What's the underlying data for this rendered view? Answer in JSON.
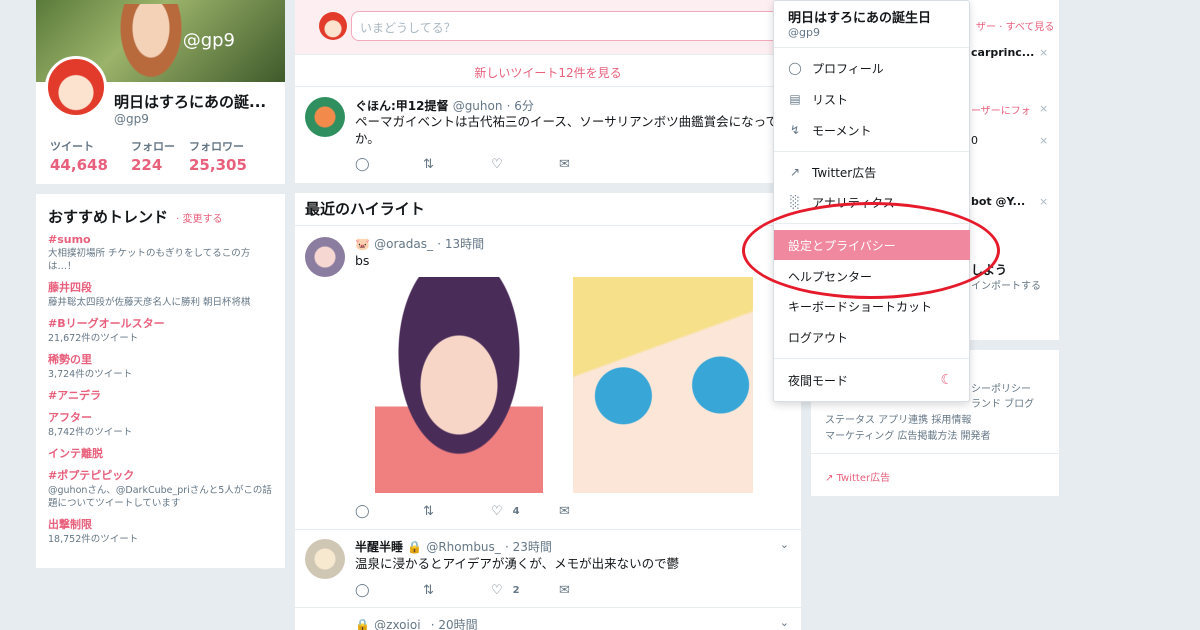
{
  "profile": {
    "name": "明日はすろにあの誕...",
    "handle": "@gp9",
    "banner_handle": "@gp9",
    "stats": [
      {
        "label": "ツイート",
        "value": "44,648"
      },
      {
        "label": "フォロー",
        "value": "224"
      },
      {
        "label": "フォロワー",
        "value": "25,305"
      }
    ]
  },
  "trends": {
    "title": "おすすめトレンド",
    "change": "· 変更する",
    "items": [
      {
        "tag": "#sumo",
        "desc": "大相撲初場所 チケットのもぎりをしてるこの方は…！"
      },
      {
        "tag": "藤井四段",
        "desc": "藤井聡太四段が佐藤天彦名人に勝利 朝日杯将棋"
      },
      {
        "tag": "#Bリーグオールスター",
        "desc": "21,672件のツイート"
      },
      {
        "tag": "稀勢の里",
        "desc": "3,724件のツイート"
      },
      {
        "tag": "#アニデラ",
        "desc": ""
      },
      {
        "tag": "アフター",
        "desc": "8,742件のツイート"
      },
      {
        "tag": "インテ離脱",
        "desc": ""
      },
      {
        "tag": "#ポプテピピック",
        "desc": "@guhonさん、@DarkCube_priさんと5人がこの話題についてツイートしています"
      },
      {
        "tag": "出撃制限",
        "desc": "18,752件のツイート"
      }
    ]
  },
  "compose": {
    "placeholder": "いまどうしてる？"
  },
  "new_tweets": "新しいツイート12件を見る",
  "tweet1": {
    "name": "ぐほん:甲12提督",
    "handle": "@guhon",
    "time": "· 6分",
    "text": "ペーマガイベントは古代祐三のイース、ソーサリアンボツ曲鑑賞会になってん",
    "text2": "か。"
  },
  "highlight": {
    "title": "最近のハイライト",
    "tweet": {
      "name": "🐷",
      "handle": "@oradas_",
      "time": "· 13時間",
      "text": "bs",
      "likes": "4"
    }
  },
  "tweet3": {
    "name": "半醒半睡",
    "handle": "@Rhombus_",
    "time": "· 23時間",
    "text": "温泉に浸かるとアイデアが湧くが、メモが出来ないので鬱",
    "likes": "2"
  },
  "tweet4": {
    "handle": "@zxoioi_",
    "time": "· 20時間"
  },
  "right": {
    "top_links": "ザー · すべて見る",
    "name1": "carprinc...",
    "follow_note": "ーザーにフォ",
    "n0": "0",
    "bot": "bot @Y...",
    "ya": "しよう",
    "import": "インポートする",
    "footer1": "シーポリシー",
    "footer2": "ランド ブログ",
    "footer3": "ステータス  アプリ連携  採用情報",
    "footer4": "マーケティング  広告掲載方法  開発者",
    "ads": "Twitter広告"
  },
  "menu": {
    "name": "明日はすろにあの誕生日",
    "handle": "@gp9",
    "items": [
      {
        "label": "プロフィール",
        "icon": "person-icon"
      },
      {
        "label": "リスト",
        "icon": "list-icon"
      },
      {
        "label": "モーメント",
        "icon": "lightning-icon"
      },
      {
        "label": "Twitter広告",
        "icon": "external-link-icon"
      },
      {
        "label": "アナリティクス",
        "icon": "bar-chart-icon"
      },
      {
        "label": "設定とプライバシー",
        "icon": ""
      },
      {
        "label": "ヘルプセンター",
        "icon": ""
      },
      {
        "label": "キーボードショートカット",
        "icon": ""
      },
      {
        "label": "ログアウト",
        "icon": ""
      },
      {
        "label": "夜間モード",
        "icon": "moon-icon"
      }
    ]
  },
  "colors": {
    "accent": "#e8607c",
    "highlight": "#f088a0",
    "annotation": "#e51b2c"
  }
}
